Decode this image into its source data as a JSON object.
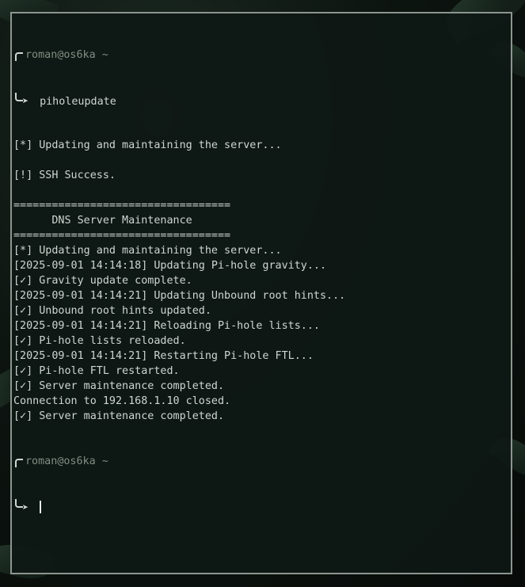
{
  "prompt": {
    "user": "roman",
    "at": "@",
    "host": "os6ka",
    "dir": "~",
    "arrow_glyph": "➤"
  },
  "command": "piholeupdate",
  "output_lines": [
    "[*] Updating and maintaining the server...",
    "",
    "[!] SSH Success.",
    "",
    "==================================",
    "      DNS Server Maintenance",
    "==================================",
    "[*] Updating and maintaining the server...",
    "[2025-09-01 14:14:18] Updating Pi-hole gravity...",
    "[✓] Gravity update complete.",
    "[2025-09-01 14:14:21] Updating Unbound root hints...",
    "[✓] Unbound root hints updated.",
    "[2025-09-01 14:14:21] Reloading Pi-hole lists...",
    "[✓] Pi-hole lists reloaded.",
    "[2025-09-01 14:14:21] Restarting Pi-hole FTL...",
    "[✓] Pi-hole FTL restarted.",
    "[✓] Server maintenance completed.",
    "Connection to 192.168.1.10 closed.",
    "[✓] Server maintenance completed."
  ],
  "colors": {
    "text": "#cfd6d2",
    "prompt_user": "#7f8f84",
    "border": "#8d9590",
    "background": "#0e1814"
  }
}
